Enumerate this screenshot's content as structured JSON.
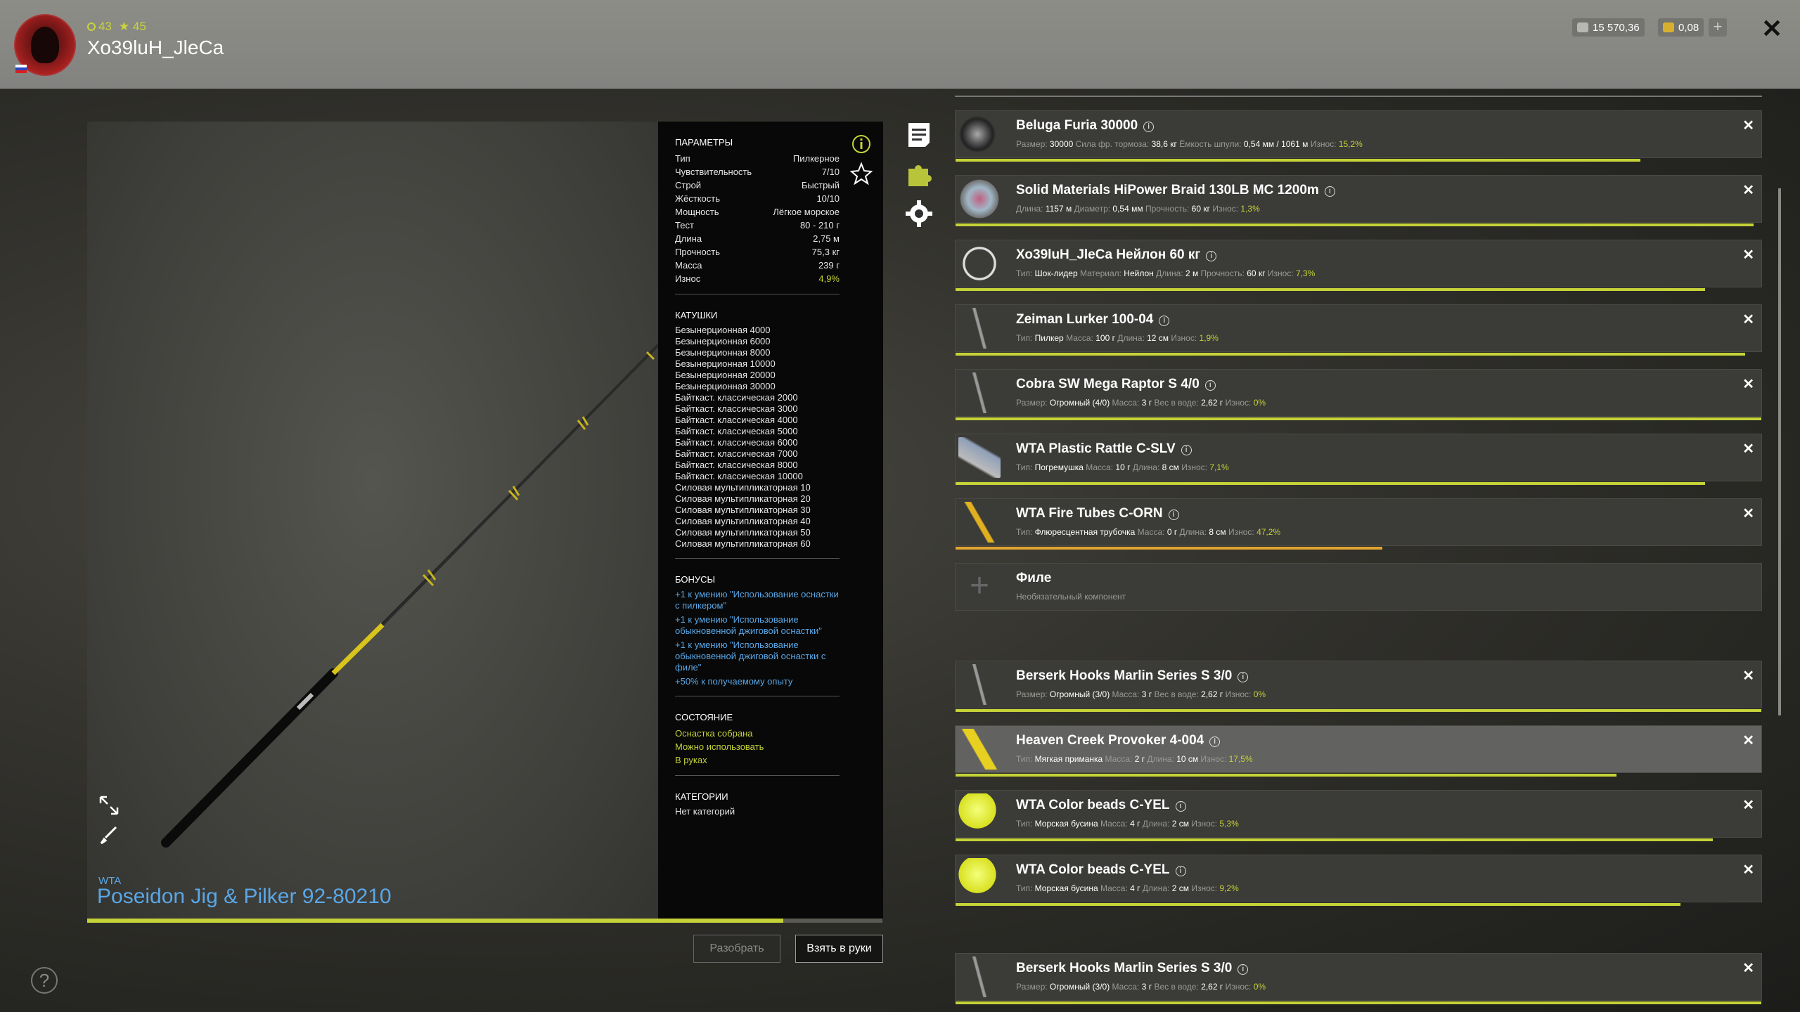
{
  "header": {
    "level": "43",
    "stars": "45",
    "username": "Хо39luН_JleCa",
    "silver": "15 570,36",
    "gold": "0,08",
    "add_label": "+",
    "close_label": "✕"
  },
  "rod": {
    "brand": "WTA",
    "name": "Poseidon Jig & Pilker 92-80210"
  },
  "params": {
    "title": "ПАРАМЕТРЫ",
    "rows": [
      {
        "k": "Тип",
        "v": "Пилкерное"
      },
      {
        "k": "Чувствительность",
        "v": "7/10"
      },
      {
        "k": "Строй",
        "v": "Быстрый"
      },
      {
        "k": "Жёсткость",
        "v": "10/10"
      },
      {
        "k": "Мощность",
        "v": "Лёгкое морское"
      },
      {
        "k": "Тест",
        "v": "80 - 210 г"
      },
      {
        "k": "Длина",
        "v": "2,75 м"
      },
      {
        "k": "Прочность",
        "v": "75,3 кг"
      },
      {
        "k": "Масса",
        "v": "239 г"
      },
      {
        "k": "Износ",
        "v": "4,9%"
      }
    ],
    "reels_title": "КАТУШКИ",
    "reels": [
      "Безынерционная 4000",
      "Безынерционная 6000",
      "Безынерционная 8000",
      "Безынерционная 10000",
      "Безынерционная 20000",
      "Безынерционная 30000",
      "Байткаст. классическая 2000",
      "Байткаст. классическая 3000",
      "Байткаст. классическая 4000",
      "Байткаст. классическая 5000",
      "Байткаст. классическая 6000",
      "Байткаст. классическая 7000",
      "Байткаст. классическая 8000",
      "Байткаст. классическая 10000",
      "Силовая мультипликаторная 10",
      "Силовая мультипликаторная 20",
      "Силовая мультипликаторная 30",
      "Силовая мультипликаторная 40",
      "Силовая мультипликаторная 50",
      "Силовая мультипликаторная 60"
    ],
    "bonuses_title": "БОНУСЫ",
    "bonuses": [
      "+1 к умению \"Использование оснастки с пилкером\"",
      "+1 к умению \"Использование обыкновенной джиговой оснастки\"",
      "+1 к умению \"Использование обыкновенной джиговой оснастки с филе\"",
      "+50% к получаемому опыту"
    ],
    "state_title": "СОСТОЯНИЕ",
    "states": [
      "Оснастка собрана",
      "Можно использовать",
      "В руках"
    ],
    "cat_title": "КАТЕГОРИИ",
    "cat_value": "Нет категорий"
  },
  "buttons": {
    "disassemble": "Разобрать",
    "take": "Взять в руки",
    "help": "?"
  },
  "tackle": [
    {
      "name": "Beluga Furia 30000",
      "details": [
        [
          "Размер:",
          "30000"
        ],
        [
          "Сила фр. тормоза:",
          "38,6 кг"
        ],
        [
          "Ёмкость шпули:",
          "0,54 мм / 1061 м"
        ],
        [
          "Износ:",
          "15,2%"
        ]
      ],
      "wear_pct": 0.85
    },
    {
      "name": "Solid Materials HiPower Braid 130LB MC 1200m",
      "details": [
        [
          "Длина:",
          "1157 м"
        ],
        [
          "Диаметр:",
          "0,54 мм"
        ],
        [
          "Прочность:",
          "60 кг"
        ],
        [
          "Износ:",
          "1,3%"
        ]
      ],
      "wear_pct": 0.99
    },
    {
      "name": "Хо39luН_JleCa Нейлон 60 кг",
      "details": [
        [
          "Тип:",
          "Шок-лидер"
        ],
        [
          "Материал:",
          "Нейлон"
        ],
        [
          "Длина:",
          "2 м"
        ],
        [
          "Прочность:",
          "60 кг"
        ],
        [
          "Износ:",
          "7,3%"
        ]
      ],
      "wear_pct": 0.93
    },
    {
      "name": "Zeiman Lurker 100-04",
      "details": [
        [
          "Тип:",
          "Пилкер"
        ],
        [
          "Масса:",
          "100 г"
        ],
        [
          "Длина:",
          "12 см"
        ],
        [
          "Износ:",
          "1,9%"
        ]
      ],
      "wear_pct": 0.98
    },
    {
      "name": "Cobra SW Mega Raptor S 4/0",
      "details": [
        [
          "Размер:",
          "Огромный (4/0)"
        ],
        [
          "Масса:",
          "3 г"
        ],
        [
          "Вес в воде:",
          "2,62 г"
        ],
        [
          "Износ:",
          "0%"
        ]
      ],
      "wear_pct": 1.0
    },
    {
      "name": "WTA Plastic Rattle C-SLV",
      "details": [
        [
          "Тип:",
          "Погремушка"
        ],
        [
          "Масса:",
          "10 г"
        ],
        [
          "Длина:",
          "8 см"
        ],
        [
          "Износ:",
          "7,1%"
        ]
      ],
      "wear_pct": 0.93
    },
    {
      "name": "WTA Fire Tubes C-ORN",
      "details": [
        [
          "Тип:",
          "Флюресцентная трубочка"
        ],
        [
          "Масса:",
          "0 г"
        ],
        [
          "Длина:",
          "8 см"
        ],
        [
          "Износ:",
          "47,2%"
        ]
      ],
      "wear_pct": 0.53
    },
    {
      "name": "Филе",
      "details": [
        [
          "Необязательный компонент",
          ""
        ]
      ],
      "wear_pct": 0
    },
    {
      "name": "Berserk Hooks Marlin Series S 3/0",
      "details": [
        [
          "Размер:",
          "Огромный (3/0)"
        ],
        [
          "Масса:",
          "3 г"
        ],
        [
          "Вес в воде:",
          "2,62 г"
        ],
        [
          "Износ:",
          "0%"
        ]
      ],
      "wear_pct": 1.0
    },
    {
      "name": "Heaven Creek Provoker 4-004",
      "details": [
        [
          "Тип:",
          "Мягкая приманка"
        ],
        [
          "Масса:",
          "2 г"
        ],
        [
          "Длина:",
          "10 см"
        ],
        [
          "Износ:",
          "17,5%"
        ]
      ],
      "wear_pct": 0.82
    },
    {
      "name": "WTA Color beads C-YEL",
      "details": [
        [
          "Тип:",
          "Морская бусина"
        ],
        [
          "Масса:",
          "4 г"
        ],
        [
          "Длина:",
          "2 см"
        ],
        [
          "Износ:",
          "5,3%"
        ]
      ],
      "wear_pct": 0.94
    },
    {
      "name": "WTA Color beads C-YEL",
      "details": [
        [
          "Тип:",
          "Морская бусина"
        ],
        [
          "Масса:",
          "4 г"
        ],
        [
          "Длина:",
          "2 см"
        ],
        [
          "Износ:",
          "9,2%"
        ]
      ],
      "wear_pct": 0.9
    },
    {
      "name": "Berserk Hooks Marlin Series S 3/0",
      "details": [
        [
          "Размер:",
          "Огромный (3/0)"
        ],
        [
          "Масса:",
          "3 г"
        ],
        [
          "Вес в воде:",
          "2,62 г"
        ],
        [
          "Износ:",
          "0%"
        ]
      ],
      "wear_pct": 1.0
    }
  ],
  "colors": {
    "accent": "#c5d238",
    "link": "#5aa7e6",
    "wear_orange": "#e0a530"
  },
  "rod_progress": 0.875
}
